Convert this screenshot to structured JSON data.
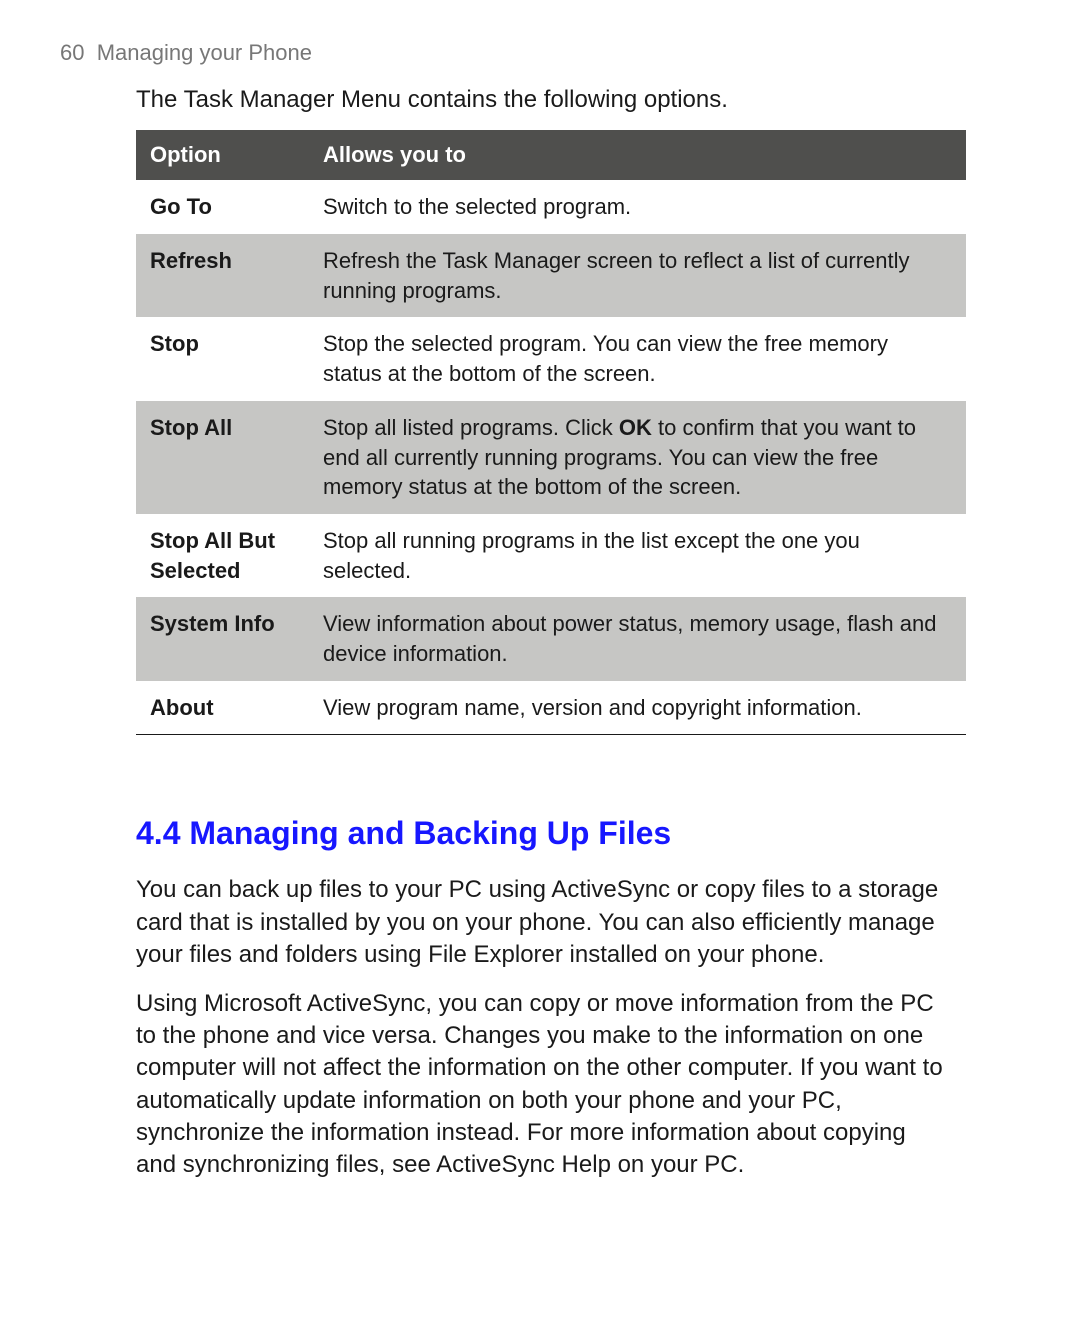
{
  "header": {
    "page_number": "60",
    "chapter_title": "Managing your Phone"
  },
  "intro_text": "The Task Manager Menu contains the following options.",
  "table": {
    "col_option": "Option",
    "col_allows": "Allows you to",
    "rows": {
      "goto": {
        "opt": "Go To",
        "desc": "Switch to the selected program."
      },
      "refresh": {
        "opt": "Refresh",
        "desc": "Refresh the Task Manager screen to reflect a list of currently running programs."
      },
      "stop": {
        "opt": "Stop",
        "desc": "Stop the selected program. You can view the free memory status at the bottom of the screen."
      },
      "stopall": {
        "opt": "Stop All",
        "desc_pre": "Stop all listed programs. Click ",
        "desc_bold": "OK",
        "desc_post": " to confirm that you want to end all currently running programs. You can view the free memory status at the bottom of the screen."
      },
      "stopallbut": {
        "opt": "Stop All But Selected",
        "desc": "Stop all running programs in the list except the one you selected."
      },
      "sysinfo": {
        "opt": "System Info",
        "desc": "View information about power status, memory usage, flash and device information."
      },
      "about": {
        "opt": "About",
        "desc": "View program name, version and copyright information."
      }
    }
  },
  "section_heading": "4.4 Managing and Backing Up Files",
  "para1": "You can back up files to your PC using ActiveSync or copy files to a storage card that is installed by you on your phone. You can also efficiently manage your files and folders using File Explorer installed on your phone.",
  "para2": "Using Microsoft ActiveSync, you can copy or move information from the PC to the phone and vice versa. Changes you make to the information on one computer will not affect the information on the other computer. If you want to automatically update information on both your phone and your PC, synchronize the information instead. For more information about copying and synchronizing files, see ActiveSync Help on your PC."
}
